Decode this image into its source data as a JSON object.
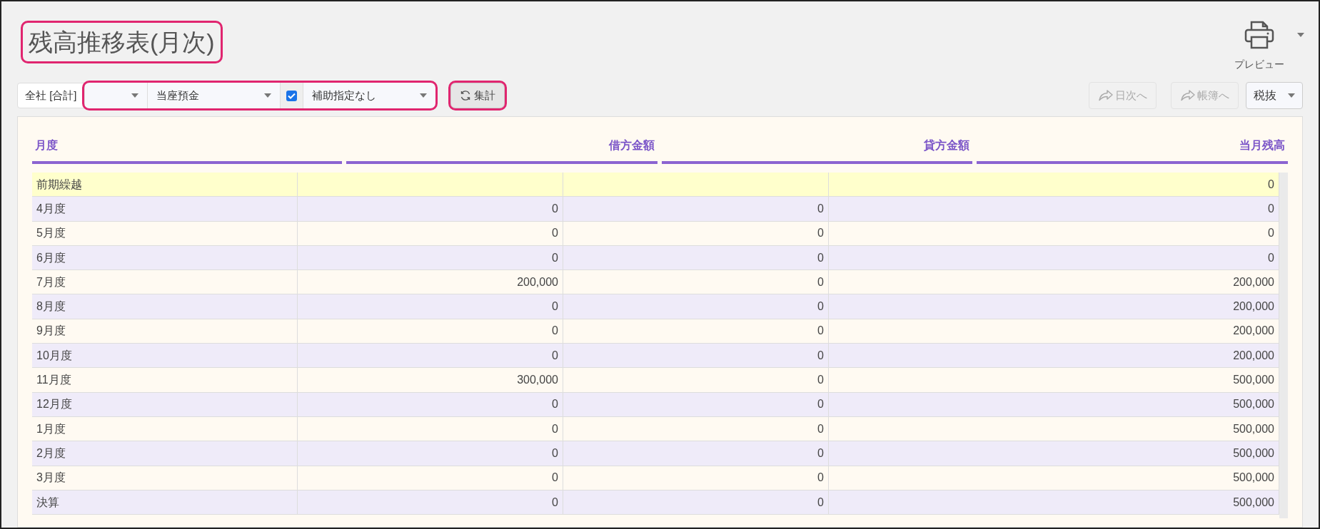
{
  "title": {
    "text": "残高推移表(月次)",
    "highlighted": true
  },
  "print": {
    "label": "プレビュー"
  },
  "toolbar": {
    "company": "全社 [合計]",
    "filters_highlighted": true,
    "filters": [
      {
        "kind": "select"
      },
      {
        "kind": "select",
        "value": "当座預金"
      },
      {
        "kind": "checkbox",
        "checked": true
      },
      {
        "kind": "select",
        "value": "補助指定なし"
      }
    ],
    "aggregate": {
      "label": "集計",
      "highlighted": true
    },
    "nav_buttons": [
      {
        "label": "日次へ",
        "disabled": true
      },
      {
        "label": "帳簿へ",
        "disabled": true
      }
    ],
    "tax": {
      "value": "税抜"
    }
  },
  "table": {
    "columns": [
      "月度",
      "借方金額",
      "貸方金額",
      "当月残高"
    ],
    "rows": [
      {
        "kind": "carry",
        "cells": [
          "前期繰越",
          "",
          "",
          "0"
        ]
      },
      {
        "kind": "month",
        "cells": [
          "4月度",
          "0",
          "0",
          "0"
        ]
      },
      {
        "kind": "month",
        "cells": [
          "5月度",
          "0",
          "0",
          "0"
        ]
      },
      {
        "kind": "month",
        "cells": [
          "6月度",
          "0",
          "0",
          "0"
        ]
      },
      {
        "kind": "month",
        "cells": [
          "7月度",
          "200,000",
          "0",
          "200,000"
        ]
      },
      {
        "kind": "month",
        "cells": [
          "8月度",
          "0",
          "0",
          "200,000"
        ]
      },
      {
        "kind": "month",
        "cells": [
          "9月度",
          "0",
          "0",
          "200,000"
        ]
      },
      {
        "kind": "month",
        "cells": [
          "10月度",
          "0",
          "0",
          "200,000"
        ]
      },
      {
        "kind": "month",
        "cells": [
          "11月度",
          "300,000",
          "0",
          "500,000"
        ]
      },
      {
        "kind": "month",
        "cells": [
          "12月度",
          "0",
          "0",
          "500,000"
        ]
      },
      {
        "kind": "month",
        "cells": [
          "1月度",
          "0",
          "0",
          "500,000"
        ]
      },
      {
        "kind": "month",
        "cells": [
          "2月度",
          "0",
          "0",
          "500,000"
        ]
      },
      {
        "kind": "month",
        "cells": [
          "3月度",
          "0",
          "0",
          "500,000"
        ]
      },
      {
        "kind": "month",
        "cells": [
          "決算",
          "0",
          "0",
          "500,000"
        ]
      }
    ]
  }
}
